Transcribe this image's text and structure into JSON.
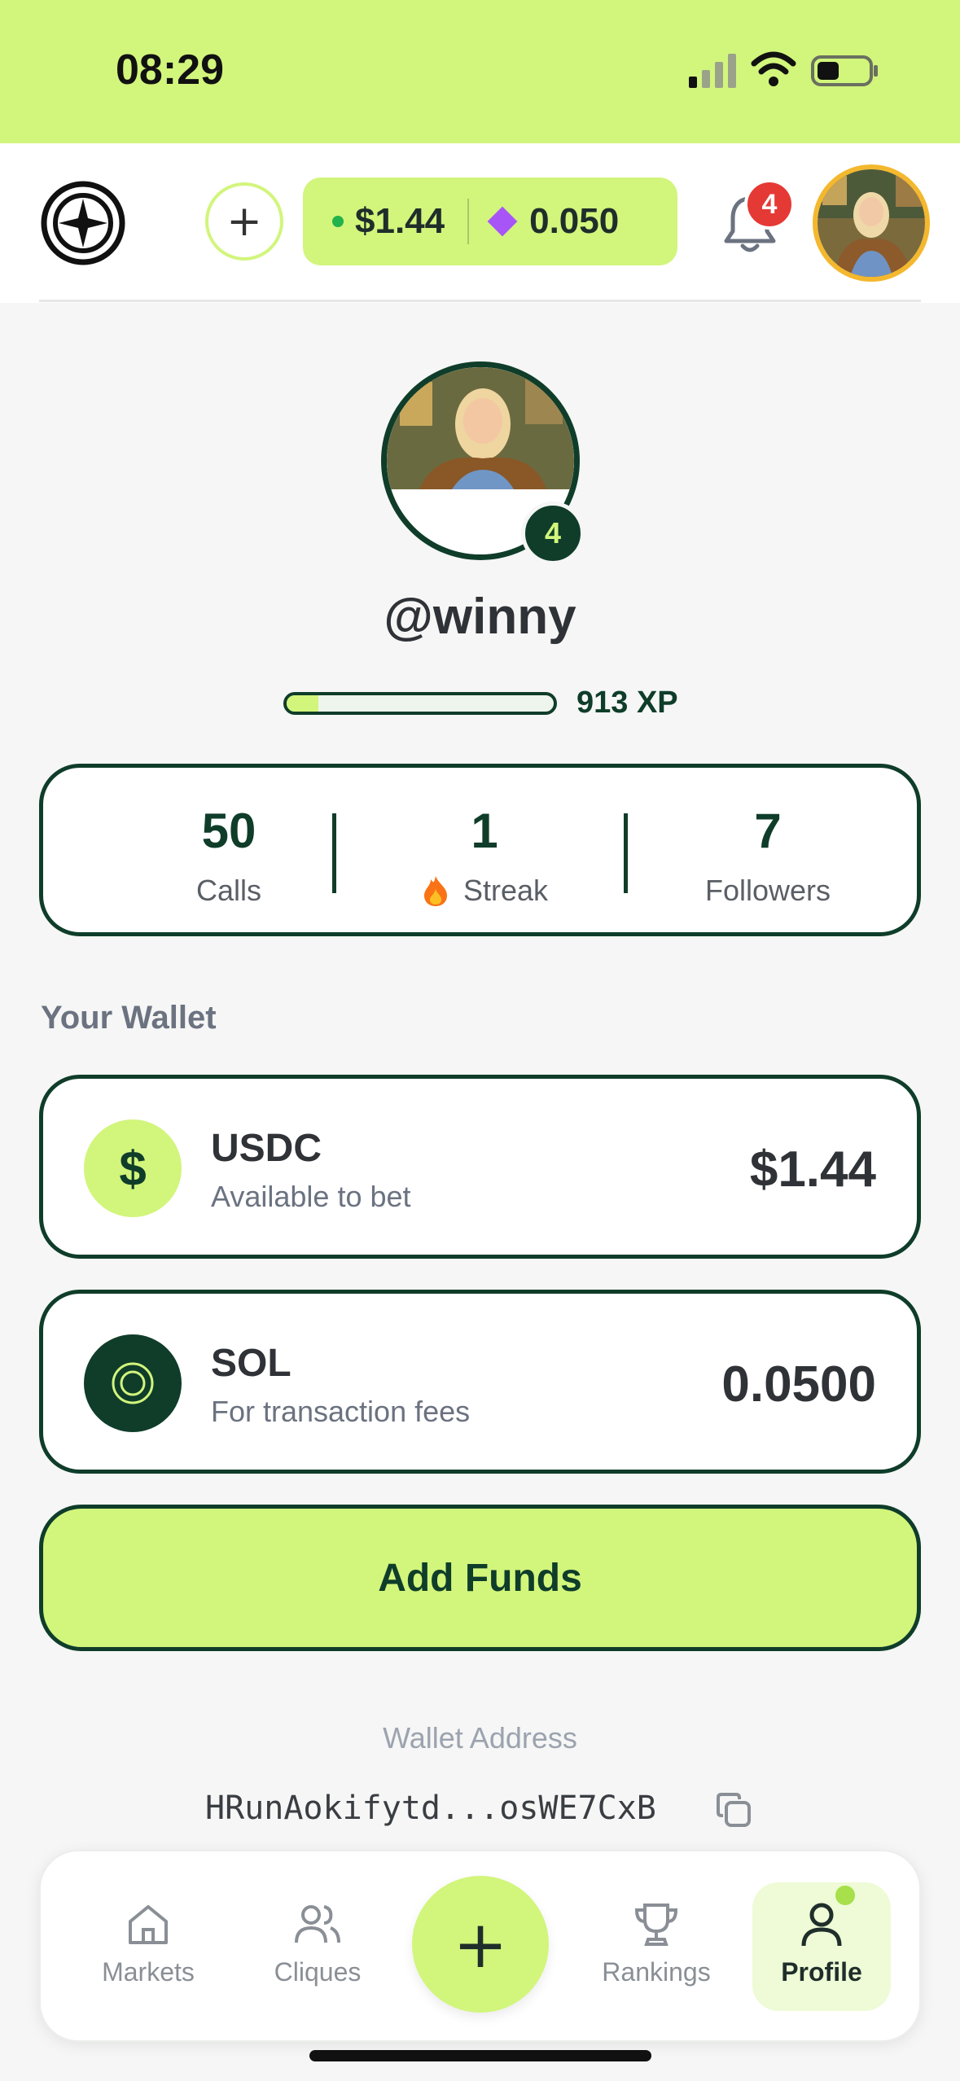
{
  "status_bar": {
    "time": "08:29",
    "signal_icon": "cellular-signal-icon",
    "wifi_icon": "wifi-icon",
    "battery_icon": "battery-icon"
  },
  "header": {
    "logo_icon": "app-logo-icon",
    "add_icon": "plus-icon",
    "usd_balance": "$1.44",
    "sol_balance": "0.050",
    "notifications_count": "4",
    "avatar": "user-avatar"
  },
  "profile": {
    "username": "@winny",
    "level": "4",
    "xp_text": "913 XP",
    "xp_progress": 0.12
  },
  "stats": {
    "calls_value": "50",
    "calls_label": "Calls",
    "streak_value": "1",
    "streak_label": "Streak",
    "followers_value": "7",
    "followers_label": "Followers"
  },
  "wallet": {
    "title": "Your Wallet",
    "usdc": {
      "name": "USDC",
      "subtitle": "Available to bet",
      "amount": "$1.44",
      "symbol": "$"
    },
    "sol": {
      "name": "SOL",
      "subtitle": "For transaction fees",
      "amount": "0.0500"
    },
    "add_funds_label": "Add Funds",
    "address_label": "Wallet Address",
    "address": "HRunAokifytd...osWE7CxB"
  },
  "tabbar": {
    "markets": "Markets",
    "cliques": "Cliques",
    "create_icon": "plus-icon",
    "rankings": "Rankings",
    "profile": "Profile"
  },
  "colors": {
    "accent": "#d2f57c",
    "dark_green": "#0f3d2a",
    "badge_red": "#e53935",
    "sol_diamond": "#a855f7"
  }
}
